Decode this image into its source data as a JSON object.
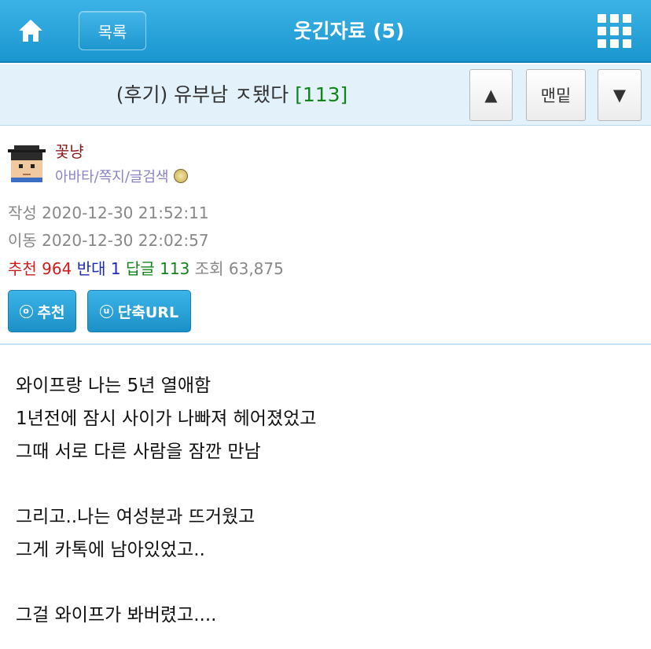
{
  "header": {
    "home_icon": "home-icon",
    "list_label": "목록",
    "board_title": "웃긴자료 (5)",
    "menu_icon": "grid-menu-icon"
  },
  "subject": {
    "title": "(후기) 유부남 ㅈ됐다",
    "reply_count": "[113]",
    "up_label": "▲",
    "bottom_label": "맨밑",
    "down_label": "▼"
  },
  "author": {
    "nickname": "꽃냥",
    "links": "아바타/쪽지/글검색",
    "avatar_icon": "avatar-graduate-icon",
    "badge_icon": "level-badge-icon"
  },
  "meta": {
    "written_label": "작성",
    "written": "2020-12-30 21:52:11",
    "moved_label": "이동",
    "moved": "2020-12-30 22:02:57",
    "recommend_label": "추천",
    "recommend": "964",
    "oppose_label": "반대",
    "oppose": "1",
    "reply_label": "답글",
    "reply": "113",
    "views_label": "조회",
    "views": "63,875"
  },
  "actions": {
    "recommend_icon_char": "ⓞ",
    "recommend_label": "추천",
    "shorturl_icon_char": "u",
    "shorturl_label": "단축URL"
  },
  "body_lines": [
    "와이프랑 나는 5년 열애함",
    "1년전에 잠시 사이가 나빠져 헤어졌었고",
    "그때 서로 다른 사람을 잠깐 만남",
    "",
    "그리고..나는 여성분과 뜨거웠고",
    "그게 카톡에 남아있었고..",
    "",
    "그걸 와이프가 봐버렸고...."
  ],
  "colors": {
    "header_blue": "#1a96cf",
    "recommend_red": "#d21b1b",
    "oppose_blue": "#1b28b8",
    "reply_green": "#11851c",
    "nickname": "#8b1a1a"
  }
}
